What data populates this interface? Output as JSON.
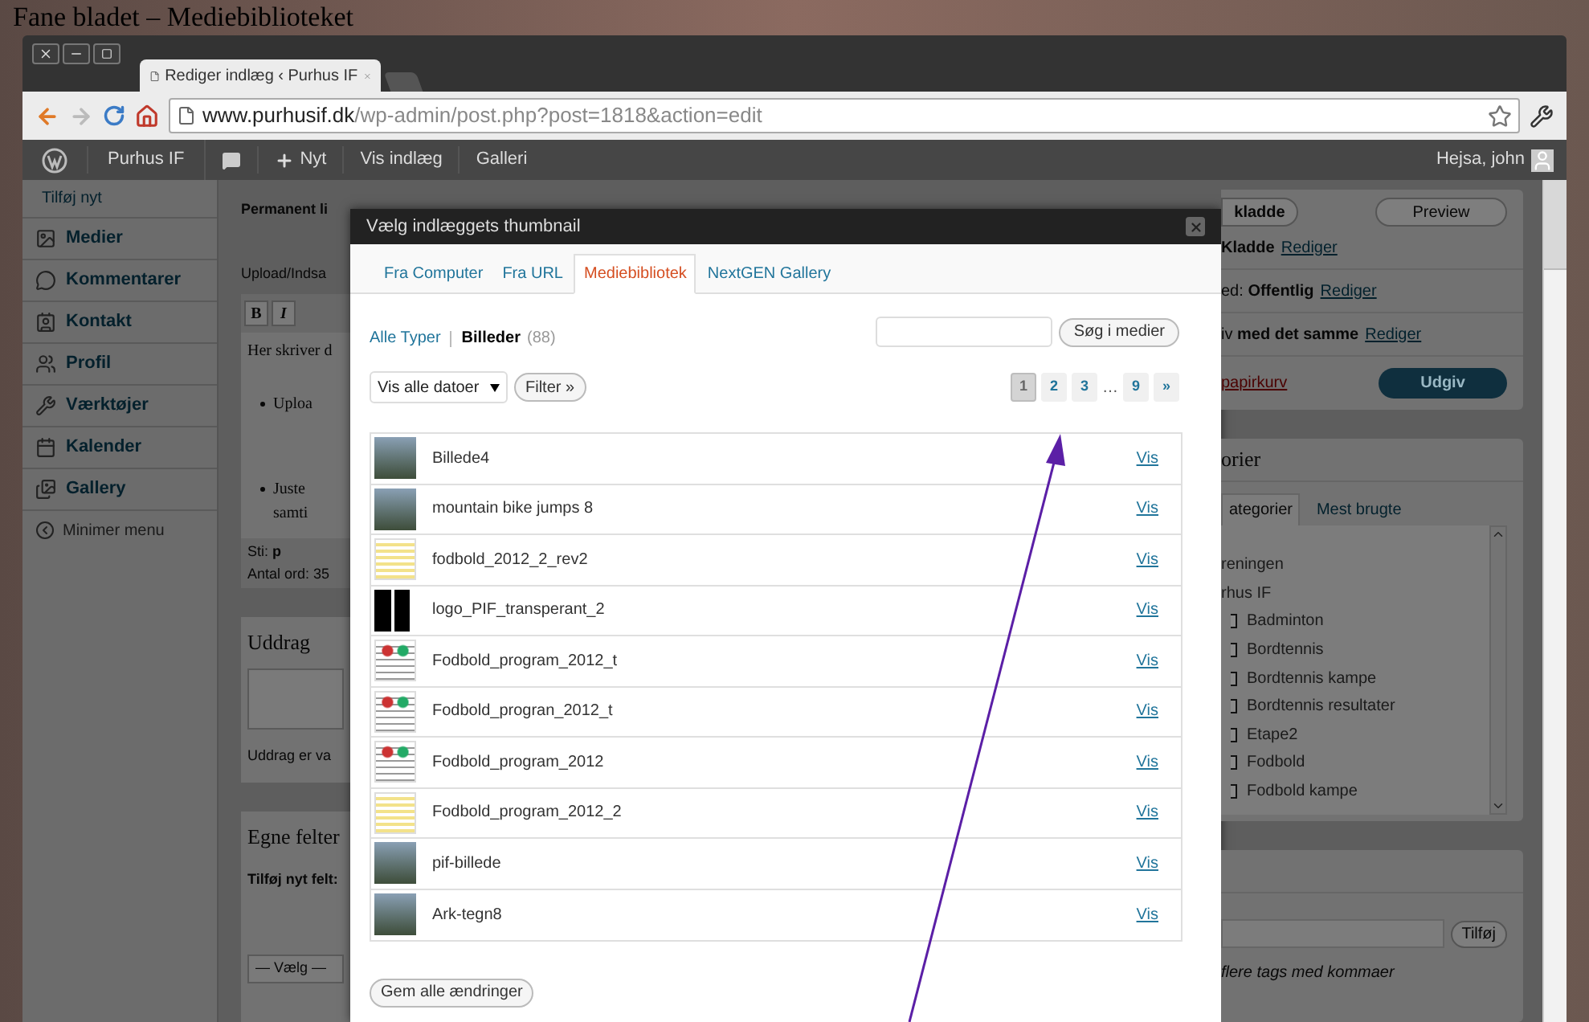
{
  "caption": "Fane bladet – Mediebiblioteket",
  "browser": {
    "tab_title": "Rediger indlæg ‹ Purhus IF",
    "url_host": "www.purhusif.dk",
    "url_path": "/wp-admin/post.php?post=1818&action=edit"
  },
  "admin_bar": {
    "site": "Purhus IF",
    "new": "Nyt",
    "links": [
      "Vis indlæg",
      "Galleri"
    ],
    "greeting": "Hejsa, john"
  },
  "sidebar": {
    "items": [
      {
        "label": "Tilføj nyt",
        "kind": "sub"
      },
      {
        "label": "Medier",
        "kind": "menu"
      },
      {
        "label": "Kommentarer",
        "kind": "menu"
      },
      {
        "label": "Kontakt",
        "kind": "menu"
      },
      {
        "label": "Profil",
        "kind": "menu"
      },
      {
        "label": "Værktøjer",
        "kind": "menu"
      },
      {
        "label": "Kalender",
        "kind": "menu"
      },
      {
        "label": "Gallery",
        "kind": "menu"
      },
      {
        "label": "Minimer menu",
        "kind": "collapse"
      }
    ]
  },
  "editor": {
    "permalink_label": "Permanent li",
    "upload_label": "Upload/Indsa",
    "toolbar": [
      "B",
      "I"
    ],
    "body_intro": "Her skriver d",
    "bullets": [
      "Uploa",
      "Juste"
    ],
    "bullet_continuation": "samti",
    "path_label": "Sti:",
    "path_value": "p",
    "word_count": "Antal ord: 35",
    "excerpt_title": "Uddrag",
    "excerpt_note": "Uddrag er va",
    "custom_fields_title": "Egne felter",
    "add_field_label": "Tilføj nyt felt:",
    "select_value": "— Vælg —"
  },
  "modal": {
    "title": "Vælg indlæggets thumbnail",
    "tabs": [
      {
        "label": "Fra Computer",
        "selected": false
      },
      {
        "label": "Fra URL",
        "selected": false
      },
      {
        "label": "Mediebibliotek",
        "selected": true
      },
      {
        "label": "NextGEN Gallery",
        "selected": false
      }
    ],
    "type_filters": [
      {
        "label": "Alle Typer",
        "selected": false
      },
      {
        "label": "Billeder",
        "selected": true,
        "count": "(88)"
      }
    ],
    "search_button": "Søg i medier",
    "date_select": "Vis alle datoer",
    "filter_button": "Filter »",
    "pages": [
      {
        "label": "1",
        "kind": "page",
        "selected": true
      },
      {
        "label": "2",
        "kind": "page",
        "selected": false
      },
      {
        "label": "3",
        "kind": "page",
        "selected": false
      },
      {
        "label": "…",
        "kind": "gap"
      },
      {
        "label": "9",
        "kind": "page",
        "selected": false
      },
      {
        "label": "»",
        "kind": "page",
        "selected": false
      }
    ],
    "items": [
      {
        "name": "Billede4",
        "kind": "photo",
        "action": "Vis"
      },
      {
        "name": "mountain bike jumps 8",
        "kind": "photo",
        "action": "Vis"
      },
      {
        "name": "fodbold_2012_2_rev2",
        "kind": "sheet",
        "action": "Vis"
      },
      {
        "name": "logo_PIF_transperant_2",
        "kind": "logo",
        "action": "Vis"
      },
      {
        "name": "Fodbold_program_2012_t",
        "kind": "flyer",
        "action": "Vis"
      },
      {
        "name": "Fodbold_progran_2012_t",
        "kind": "flyer",
        "action": "Vis"
      },
      {
        "name": "Fodbold_program_2012",
        "kind": "flyer",
        "action": "Vis"
      },
      {
        "name": "Fodbold_program_2012_2",
        "kind": "sheet",
        "action": "Vis"
      },
      {
        "name": "pif-billede",
        "kind": "photo",
        "action": "Vis"
      },
      {
        "name": "Ark-tegn8",
        "kind": "photo",
        "action": "Vis"
      }
    ],
    "save_button": "Gem alle ændringer"
  },
  "publish_panel": {
    "draft_button": "kladde",
    "preview_button": "Preview",
    "rows": [
      {
        "text": "**Kladde**",
        "link": "Rediger"
      },
      {
        "text": "ed: **Offentlig**",
        "link": "Rediger"
      },
      {
        "text": "iv **med det samme**",
        "link": "Rediger"
      }
    ],
    "trash_link": "papirkurv",
    "publish_button": "Udgiv"
  },
  "categories_panel": {
    "title": "orier",
    "tabs": [
      {
        "label": "ategorier",
        "selected": true
      },
      {
        "label": "Mest brugte",
        "selected": false
      }
    ],
    "items": [
      {
        "label": "reningen"
      },
      {
        "label": "rhus IF",
        "children": [
          {
            "label": "Badminton",
            "checked": false
          },
          {
            "label": "Bordtennis",
            "checked": false
          },
          {
            "label": "Bordtennis kampe",
            "checked": false
          },
          {
            "label": "Bordtennis resultater",
            "checked": false
          },
          {
            "label": "Etape2",
            "checked": false
          },
          {
            "label": "Fodbold",
            "checked": false
          },
          {
            "label": "Fodbold kampe",
            "checked": false
          }
        ]
      }
    ]
  },
  "tags_panel": {
    "button": "Tilføj",
    "hint": "flere tags med kommaer"
  }
}
